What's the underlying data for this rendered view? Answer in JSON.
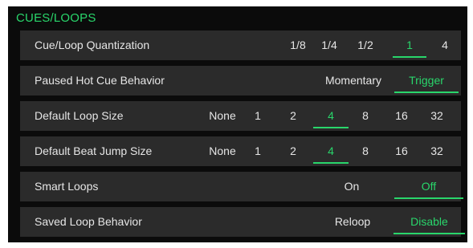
{
  "section": {
    "title": "CUES/LOOPS"
  },
  "rows": [
    {
      "label": "Cue/Loop Quantization",
      "options": [
        "1/8",
        "1/4",
        "1/2",
        "1",
        "4"
      ],
      "selected": "1"
    },
    {
      "label": "Paused Hot Cue Behavior",
      "options": [
        "Momentary",
        "Trigger"
      ],
      "selected": "Trigger"
    },
    {
      "label": "Default Loop Size",
      "options": [
        "None",
        "1",
        "2",
        "4",
        "8",
        "16",
        "32"
      ],
      "selected": "4"
    },
    {
      "label": "Default Beat Jump Size",
      "options": [
        "None",
        "1",
        "2",
        "4",
        "8",
        "16",
        "32"
      ],
      "selected": "4"
    },
    {
      "label": "Smart Loops",
      "options": [
        "On",
        "Off"
      ],
      "selected": "Off"
    },
    {
      "label": "Saved Loop Behavior",
      "options": [
        "Reloop",
        "Disable"
      ],
      "selected": "Disable"
    }
  ],
  "colors": {
    "accent": "#29d66b",
    "row_bg": "#2b2b2b",
    "panel_bg": "#0b0b0b",
    "text": "#e6e6e6"
  }
}
